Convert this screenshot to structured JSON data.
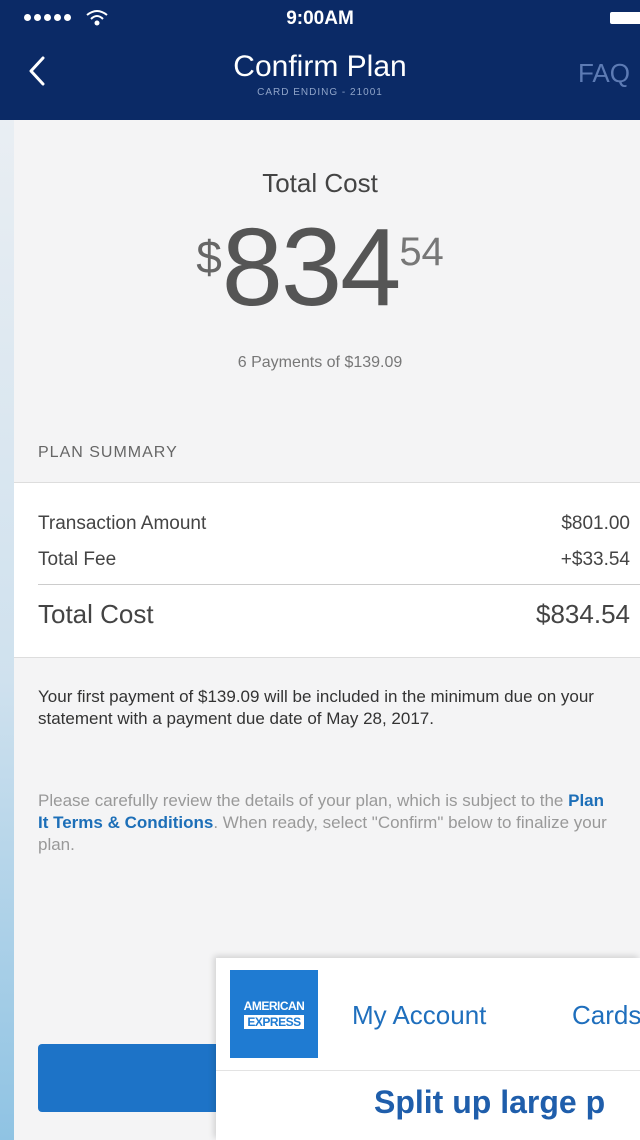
{
  "status_bar": {
    "time": "9:00AM"
  },
  "header": {
    "title": "Confirm Plan",
    "subtitle": "CARD ENDING - 21001",
    "faq_label": "FAQ"
  },
  "summary_top": {
    "label": "Total Cost",
    "currency_symbol": "$",
    "dollars": "834",
    "cents": "54",
    "payments_text": "6 Payments of $139.09"
  },
  "plan_summary": {
    "heading": "PLAN SUMMARY",
    "rows": [
      {
        "label": "Transaction Amount",
        "value": "$801.00"
      },
      {
        "label": "Total Fee",
        "value": "+$33.54"
      }
    ],
    "total": {
      "label": "Total Cost",
      "value": "$834.54"
    }
  },
  "info_text": "Your first payment of $139.09 will be included in the minimum due on your statement with a payment due date of May 28, 2017.",
  "review": {
    "before": "Please carefully review the details of your plan, which is subject to the ",
    "link": "Plan It Terms & Conditions",
    "after": ". When ready, select \"Confirm\" below to finalize your plan."
  },
  "overlay": {
    "logo_line1": "AMERICAN",
    "logo_line2": "EXPRESS",
    "nav_account": "My Account",
    "nav_cards": "Cards",
    "headline": "Split up large p"
  },
  "colors": {
    "header_bg": "#0b2a66",
    "primary_button": "#1d73c7",
    "link": "#1d6fb8",
    "amex_blue": "#1f7bd2"
  }
}
